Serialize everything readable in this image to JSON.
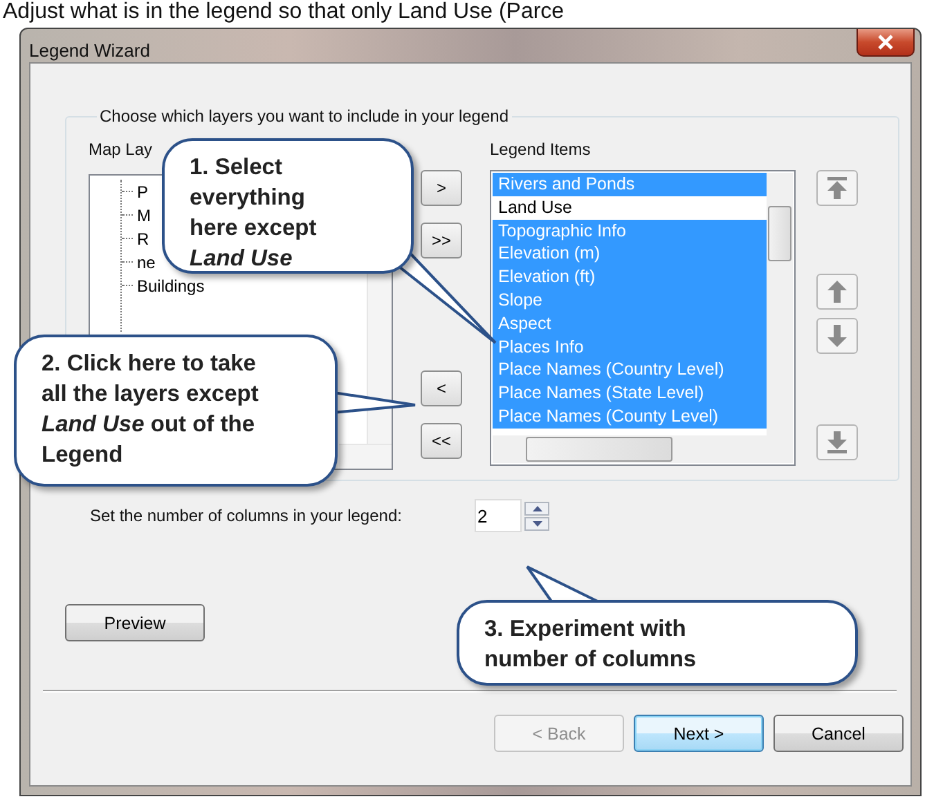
{
  "caption": "Adjust what is in the legend so that only Land Use (Parce",
  "window": {
    "title": "Legend Wizard"
  },
  "group": {
    "title": "Choose which layers you want to include in your legend"
  },
  "map_layers": {
    "label": "Map Lay",
    "items": [
      "P",
      "M",
      "R",
      "ne",
      "Buildings"
    ]
  },
  "transfer_buttons": [
    ">",
    ">>",
    "<",
    "<<"
  ],
  "legend_items": {
    "label": "Legend Items",
    "items": [
      {
        "label": "Rivers and Ponds",
        "selected": true
      },
      {
        "label": "Land Use",
        "selected": false
      },
      {
        "label": "Topographic Info",
        "selected": true
      },
      {
        "label": "Elevation (m)",
        "selected": true
      },
      {
        "label": "Elevation (ft)",
        "selected": true
      },
      {
        "label": "Slope",
        "selected": true
      },
      {
        "label": "Aspect",
        "selected": true
      },
      {
        "label": "Places Info",
        "selected": true
      },
      {
        "label": "Place Names (Country Level)",
        "selected": true
      },
      {
        "label": "Place Names (State Level)",
        "selected": true
      },
      {
        "label": "Place Names (County Level)",
        "selected": true
      }
    ]
  },
  "columns": {
    "label": "Set the number of columns in your legend:",
    "value": "2"
  },
  "preview_button": "Preview",
  "nav_buttons": [
    {
      "label": "< Back",
      "disabled": true,
      "default": false
    },
    {
      "label": "Next >",
      "disabled": false,
      "default": true
    },
    {
      "label": "Cancel",
      "disabled": false,
      "default": false
    }
  ],
  "callouts": [
    {
      "text": "1. Select everything here except *Land Use*"
    },
    {
      "text": "2. Click here to take all the layers except *Land Use* out of the Legend"
    },
    {
      "text": "3. Experiment with number of columns"
    }
  ]
}
